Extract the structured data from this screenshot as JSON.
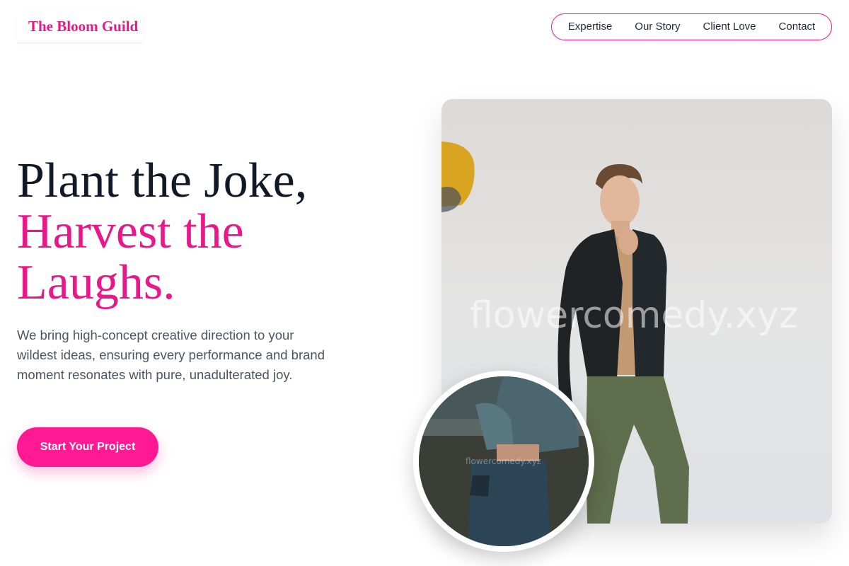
{
  "brand": {
    "name": "The Bloom Guild",
    "accent": "#e8188a",
    "button": "#ff1a93"
  },
  "nav": {
    "items": [
      {
        "label": "Expertise"
      },
      {
        "label": "Our Story"
      },
      {
        "label": "Client Love"
      },
      {
        "label": "Contact"
      }
    ]
  },
  "hero": {
    "headline_line1": "Plant the Joke,",
    "headline_line2": "Harvest the",
    "headline_line3": "Laughs.",
    "subtext": "We bring high-concept creative direction to your wildest ideas, ensuring every performance and brand moment resonates with pure, unadulterated joy.",
    "cta_label": "Start Your Project"
  },
  "images": {
    "main_watermark": "flowercomedy.xyz",
    "inset_watermark": "flowercomedy.xyz"
  }
}
